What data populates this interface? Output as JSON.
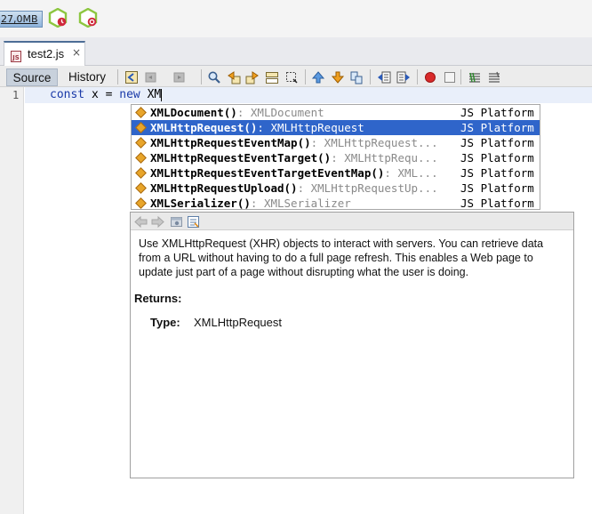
{
  "top_toolbar": {
    "memory_label": "27,0MB",
    "gc_buttons": [
      "profile-ide-icon",
      "profile-snapshot-icon"
    ]
  },
  "tab": {
    "label": "test2.js",
    "close_glyph": "×",
    "icon": "javascript-file-icon"
  },
  "editor_toolbar": {
    "source_label": "Source",
    "history_label": "History",
    "icons": [
      "last-edit-icon",
      "back-icon",
      "forward-icon",
      "find-selection-icon",
      "find-previous-icon",
      "find-next-icon",
      "toggle-highlight-icon",
      "toggle-rect-select-icon",
      "previous-bookmark-icon",
      "next-bookmark-icon",
      "toggle-bookmark-icon",
      "shift-left-icon",
      "shift-right-icon",
      "start-macro-icon",
      "stop-macro-icon",
      "comment-icon",
      "uncomment-icon"
    ]
  },
  "editor": {
    "line_number": "1",
    "code": {
      "kw1": "const",
      "mid": " x = ",
      "kw2": "new",
      "rest": " XM"
    }
  },
  "completion": {
    "items": [
      {
        "name": "XMLDocument()",
        "type": ": XMLDocument",
        "platform": "JS Platform",
        "selected": false
      },
      {
        "name": "XMLHttpRequest()",
        "type": ": XMLHttpRequest",
        "platform": "JS Platform",
        "selected": true
      },
      {
        "name": "XMLHttpRequestEventMap()",
        "type": ": XMLHttpRequest...",
        "platform": "JS Platform",
        "selected": false
      },
      {
        "name": "XMLHttpRequestEventTarget()",
        "type": ": XMLHttpRequ...",
        "platform": "JS Platform",
        "selected": false
      },
      {
        "name": "XMLHttpRequestEventTargetEventMap()",
        "type": ": XML...",
        "platform": "JS Platform",
        "selected": false
      },
      {
        "name": "XMLHttpRequestUpload()",
        "type": ": XMLHttpRequestUp...",
        "platform": "JS Platform",
        "selected": false
      },
      {
        "name": "XMLSerializer()",
        "type": ": XMLSerializer",
        "platform": "JS Platform",
        "selected": false
      }
    ]
  },
  "documentation": {
    "toolbar_icons": [
      "back-icon",
      "forward-icon",
      "open-in-browser-icon",
      "goto-source-icon"
    ],
    "description": "Use XMLHttpRequest (XHR) objects to interact with servers. You can retrieve data from a URL without having to do a full page refresh. This enables a Web page to update just part of a page without disrupting what the user is doing.",
    "returns_label": "Returns:",
    "type_label": "Type:",
    "type_value": "XMLHttpRequest"
  },
  "colors": {
    "selection": "#2f65ca",
    "keyword": "#1a3aa8",
    "method_icon": "#e8a52a",
    "current_line": "#e9effa"
  }
}
